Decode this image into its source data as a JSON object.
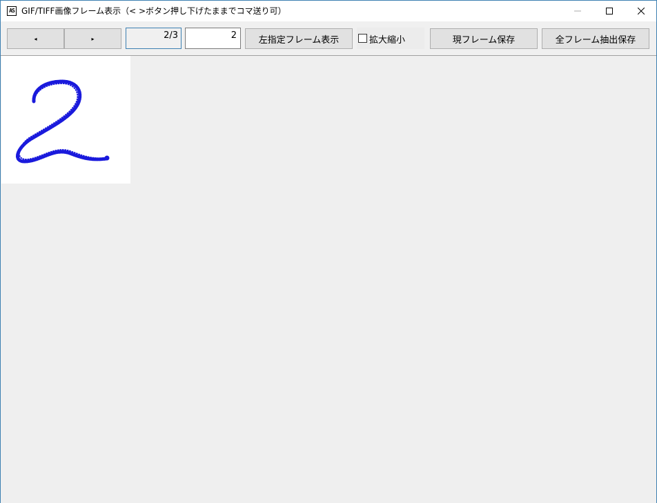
{
  "window": {
    "title": "GIF/TIFF画像フレーム表示（< >ボタン押し下げたままでコマ送り可）",
    "icon_text": "AS"
  },
  "caption_buttons": {
    "minimize": "—",
    "maximize": "☐",
    "close": "✕"
  },
  "toolbar": {
    "prev_arrow": "◂",
    "next_arrow": "▸",
    "frame_position": "2/3",
    "frame_number_input": "2",
    "show_frame_label": "左指定フレーム表示",
    "zoom_checkbox_label": "拡大縮小",
    "zoom_checked": false,
    "save_frame_label": "現フレーム保存",
    "save_all_label": "全フレーム抽出保存"
  },
  "image": {
    "content": "handwritten digit 2",
    "stroke_color": "#1a1adc"
  }
}
